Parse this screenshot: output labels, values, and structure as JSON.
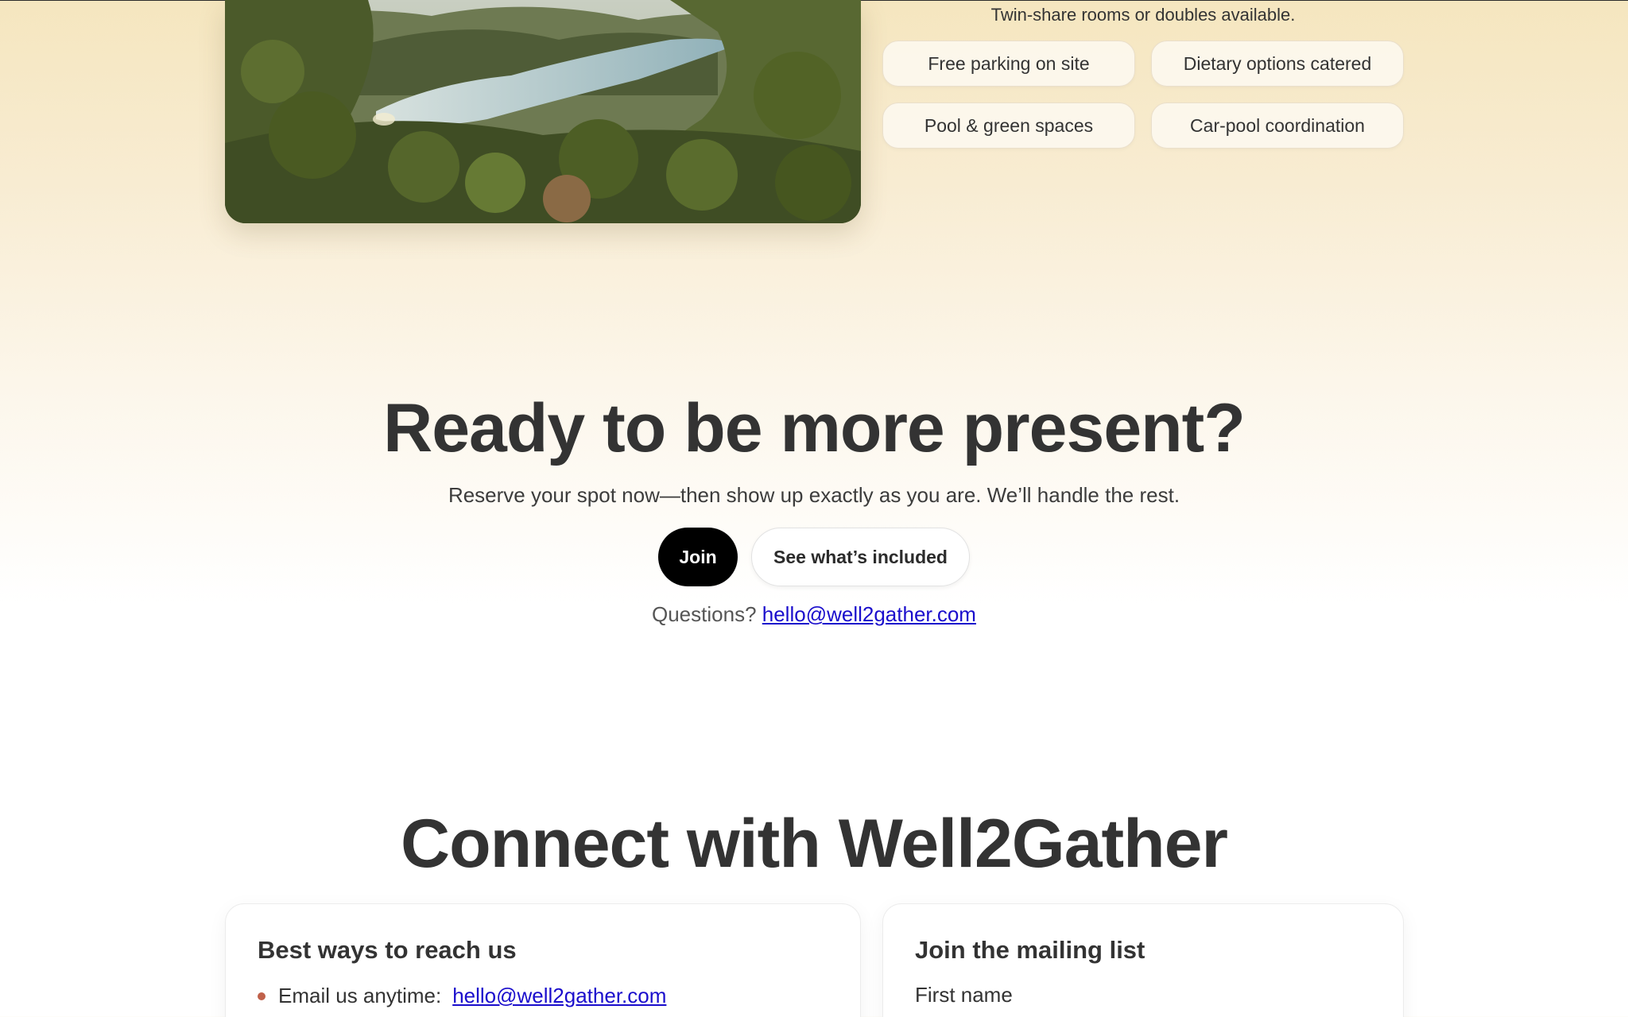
{
  "stay": {
    "rooms_note": "Twin-share rooms or doubles available.",
    "amenities": [
      "Free parking on site",
      "Dietary options catered",
      "Pool & green spaces",
      "Car-pool coordination"
    ]
  },
  "cta": {
    "title": "Ready to be more present?",
    "subtitle": "Reserve your spot now—then show up exactly as you are. We’ll handle the rest.",
    "join_label": "Join",
    "included_label": "See what’s included",
    "questions_label": "Questions?",
    "email": "hello@well2gather.com"
  },
  "connect": {
    "title": "Connect with Well2Gather",
    "reach": {
      "heading": "Best ways to reach us",
      "email_label": "Email us anytime:",
      "email": "hello@well2gather.com"
    },
    "mailing": {
      "heading": "Join the mailing list",
      "first_name_label": "First name"
    }
  },
  "colors": {
    "bullet": "#c0614a",
    "link": "#1a0dcc",
    "primary_button": "#000000"
  }
}
